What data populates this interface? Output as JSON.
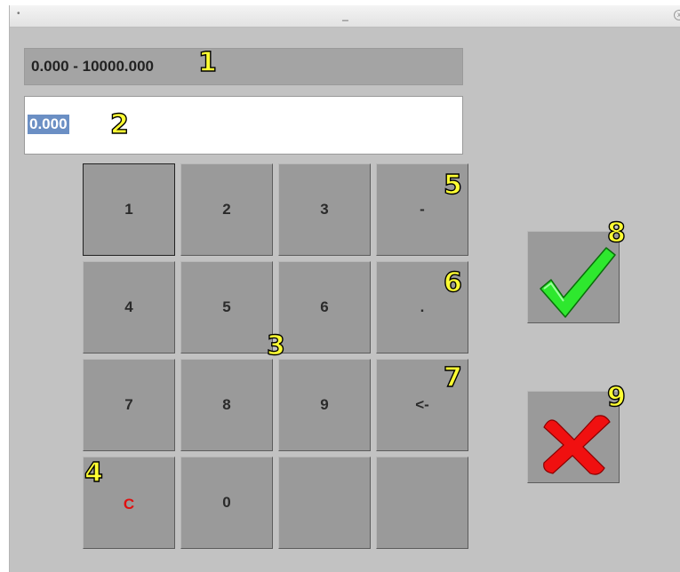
{
  "window": {
    "title": "_",
    "left_control": "•",
    "close_control": "x"
  },
  "range_display": "0.000 - 10000.000",
  "entry_value": "0.000",
  "keypad": {
    "keys": [
      "1",
      "2",
      "3",
      "-",
      "4",
      "5",
      "6",
      ".",
      "7",
      "8",
      "9",
      "<-",
      "C",
      "0",
      "",
      ""
    ]
  },
  "actions": {
    "confirm_icon": "checkmark-icon",
    "cancel_icon": "x-mark-icon"
  },
  "callouts": [
    "1",
    "2",
    "3",
    "4",
    "5",
    "6",
    "7",
    "8",
    "9"
  ],
  "colors": {
    "window_bg": "#c2c2c2",
    "key_bg": "#9a9a9a",
    "range_bg": "#a4a4a4",
    "selection": "#6b8fc4",
    "check_green": "#2ee82e",
    "cancel_red": "#f01010",
    "clear_red": "#e01010",
    "callout_yellow": "#ffff33"
  }
}
